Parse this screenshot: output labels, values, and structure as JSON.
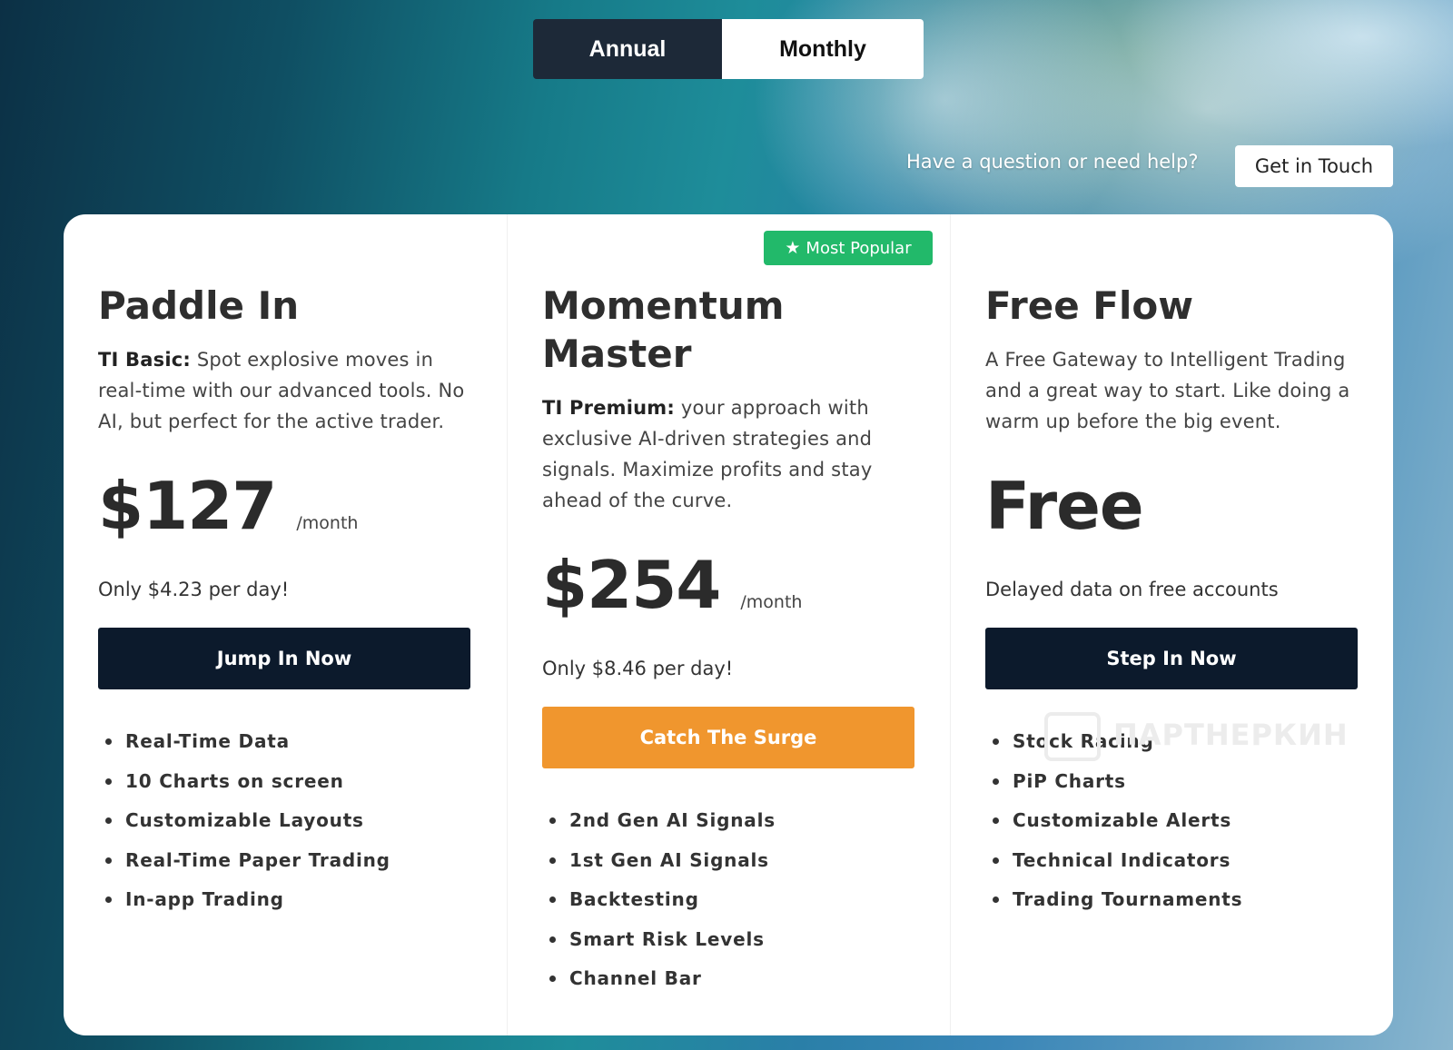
{
  "billing_toggle": {
    "annual": "Annual",
    "monthly": "Monthly"
  },
  "help": {
    "text": "Have a question or need help?",
    "button": "Get in Touch"
  },
  "badge": {
    "label": "Most Popular",
    "icon": "star-icon"
  },
  "plans": [
    {
      "name": "Paddle In",
      "desc_bold": "TI Basic:",
      "desc": " Spot explosive moves in real-time with our advanced tools. No AI, but perfect for the active trader.",
      "price": "$127",
      "per": "/month",
      "daily": "Only $4.23 per day!",
      "cta": "Jump In Now",
      "features": [
        "Real-Time Data",
        "10 Charts on screen",
        "Customizable Layouts",
        "Real-Time Paper Trading",
        "In-app Trading"
      ]
    },
    {
      "name": "Momentum Master",
      "desc_bold": "TI Premium:",
      "desc": " your approach with exclusive AI-driven strategies and signals. Maximize profits and stay ahead of the curve.",
      "price": "$254",
      "per": "/month",
      "daily": "Only $8.46 per day!",
      "cta": "Catch The Surge",
      "features": [
        "2nd Gen AI Signals",
        "1st Gen AI Signals",
        "Backtesting",
        "Smart Risk Levels",
        "Channel Bar"
      ]
    },
    {
      "name": "Free Flow",
      "desc": "A Free Gateway to Intelligent Trading and a great way to start. Like doing a warm up before the big event.",
      "price": "Free",
      "daily": "Delayed data on free accounts",
      "cta": "Step In Now",
      "features": [
        "Stock Racing",
        "PiP Charts",
        "Customizable Alerts",
        "Technical Indicators",
        "Trading Tournaments"
      ]
    }
  ],
  "watermark": "ПАРТНЕРКИН",
  "colors": {
    "dark_button": "#0c1a2c",
    "orange_button": "#f0962e",
    "badge_green": "#22b96a"
  }
}
